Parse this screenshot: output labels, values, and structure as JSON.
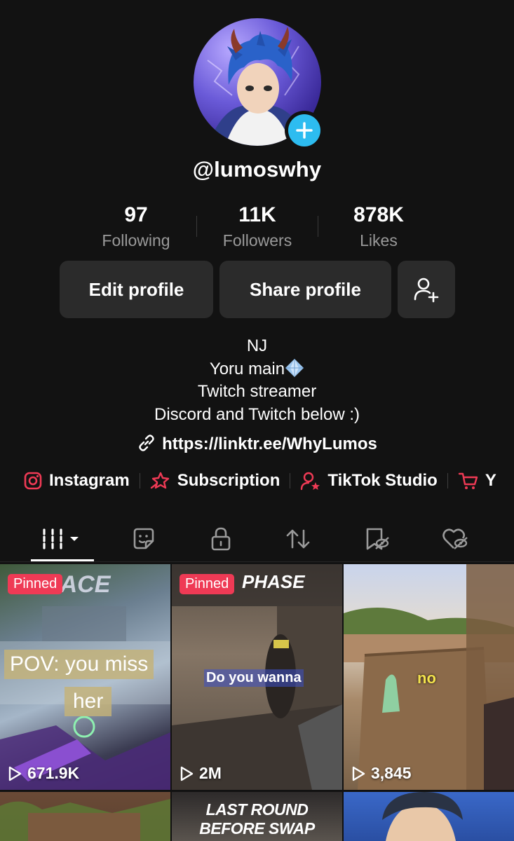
{
  "profile": {
    "username": "@lumoswhy",
    "stats": [
      {
        "value": "97",
        "label": "Following"
      },
      {
        "value": "11K",
        "label": "Followers"
      },
      {
        "value": "878K",
        "label": "Likes"
      }
    ],
    "buttons": {
      "edit": "Edit profile",
      "share": "Share profile"
    },
    "bio": [
      "NJ",
      "Yoru main",
      "Twitch streamer",
      "Discord and Twitch below :)"
    ],
    "link": "https://linktr.ee/WhyLumos"
  },
  "social_links": [
    {
      "label": "Instagram",
      "icon": "instagram-icon"
    },
    {
      "label": "Subscription",
      "icon": "subscription-icon"
    },
    {
      "label": "TikTok Studio",
      "icon": "tiktok-studio-icon"
    },
    {
      "label": "Y",
      "icon": "shop-cart-icon"
    }
  ],
  "tabs": [
    {
      "icon": "videos-grid-icon",
      "active": true
    },
    {
      "icon": "sticker-icon"
    },
    {
      "icon": "lock-icon"
    },
    {
      "icon": "repost-icon"
    },
    {
      "icon": "favorites-icon"
    },
    {
      "icon": "liked-icon"
    }
  ],
  "videos": [
    {
      "pinned_label": "Pinned",
      "views": "671.9K",
      "caption_1": "POV: you miss",
      "caption_2": "her",
      "hud_text": "ACE"
    },
    {
      "pinned_label": "Pinned",
      "views": "2M",
      "caption_1": "Do you wanna",
      "hud_text": "PHASE"
    },
    {
      "views": "3,845",
      "caption_1": "no"
    },
    {},
    {
      "caption_1": "LAST ROUND BEFORE SWAP"
    },
    {}
  ],
  "colors": {
    "background": "#121212",
    "button": "#2b2b2b",
    "accent_red": "#ef3a55",
    "accent_blue": "#2dbcf0",
    "muted_text": "#9a9a9a"
  }
}
